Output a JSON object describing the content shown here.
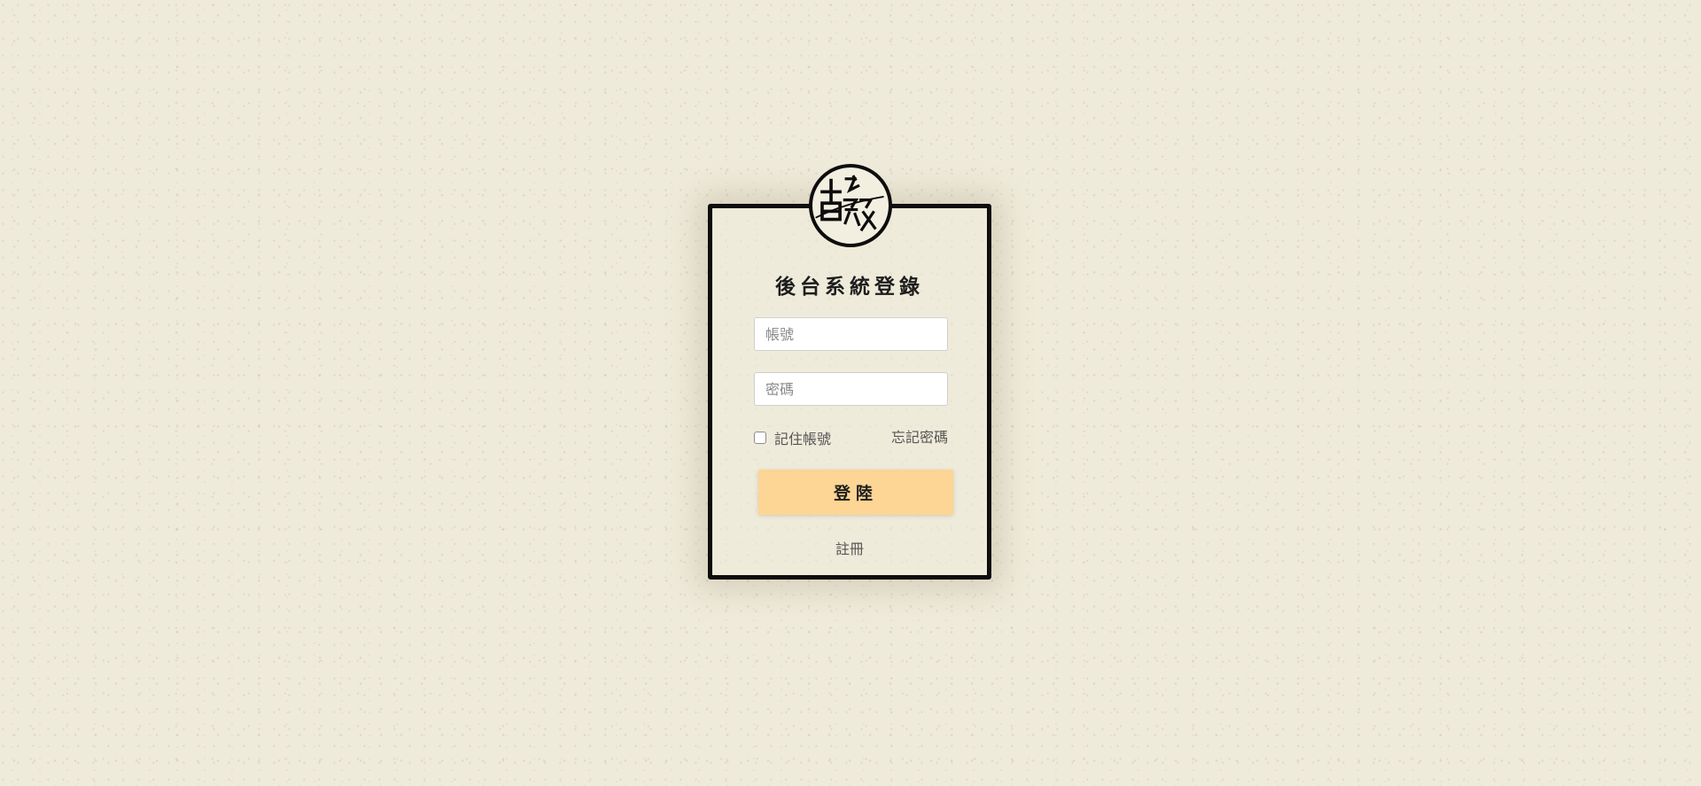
{
  "login": {
    "title": "後台系統登錄",
    "account_placeholder": "帳號",
    "account_value": "",
    "password_placeholder": "密碼",
    "password_value": "",
    "remember_label": "記住帳號",
    "remember_checked": false,
    "forgot_label": "忘記密碼",
    "submit_label": "登陸",
    "register_label": "註冊"
  },
  "logo": {
    "icon": "brand-seal-logo",
    "glyphs": [
      "吉",
      "發"
    ]
  },
  "colors": {
    "background": "#efebdb",
    "frame_border": "#0d0d0d",
    "submit_button": "#fdd594",
    "text_muted": "#555555"
  }
}
